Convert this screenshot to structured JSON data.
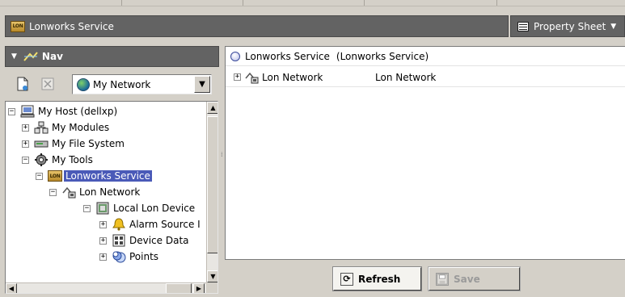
{
  "window": {
    "title": "Lonworks Service",
    "view_selector": "Property Sheet"
  },
  "nav": {
    "title": "Nav",
    "network_select": "My Network",
    "tree": [
      {
        "label": "My Host (dellxp)",
        "icon": "host-icon",
        "expander": "−"
      },
      {
        "label": "My Modules",
        "icon": "modules-icon",
        "expander": "+"
      },
      {
        "label": "My File System",
        "icon": "file-system-icon",
        "expander": "+"
      },
      {
        "label": "My Tools",
        "icon": "tools-icon",
        "expander": "−"
      },
      {
        "label": "Lonworks Service",
        "icon": "lonworks-icon",
        "expander": "−",
        "selected": true
      },
      {
        "label": "Lon Network",
        "icon": "network-icon",
        "expander": "−"
      },
      {
        "label": "Local Lon Device",
        "icon": "device-icon",
        "expander": "−"
      },
      {
        "label": "Alarm Source I",
        "icon": "bell-icon",
        "expander": "+"
      },
      {
        "label": "Device Data",
        "icon": "device-data-icon",
        "expander": "+"
      },
      {
        "label": "Points",
        "icon": "points-icon",
        "expander": "+"
      }
    ]
  },
  "property_sheet": {
    "root_name": "Lonworks Service",
    "root_type": "(Lonworks Service)",
    "rows": [
      {
        "name": "Lon Network",
        "value": "Lon Network"
      }
    ]
  },
  "buttons": {
    "refresh": "Refresh",
    "save": "Save"
  },
  "colors": {
    "header_bg": "#636363",
    "selection": "#4a5ab8",
    "panel_bg": "#d4d0c8"
  }
}
